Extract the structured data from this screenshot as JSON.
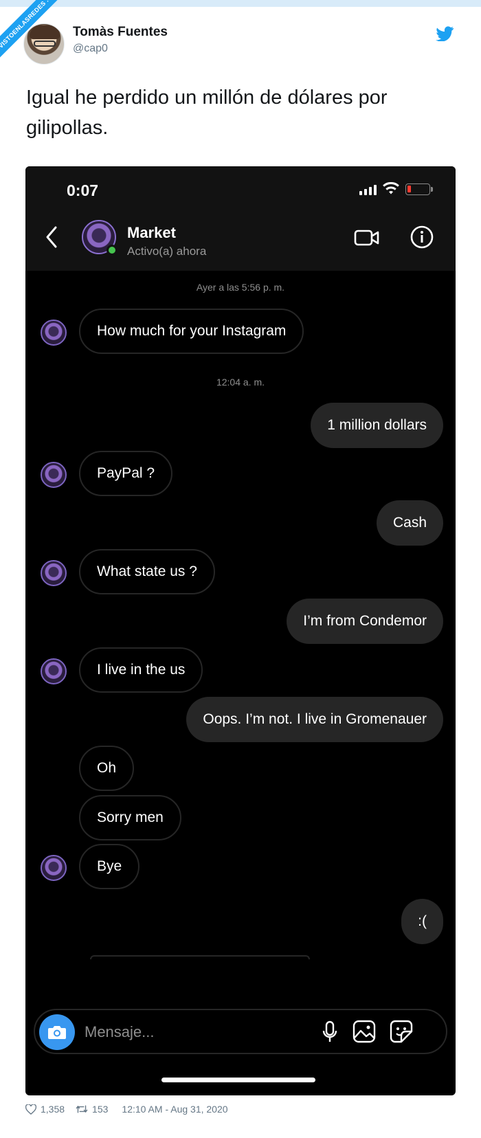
{
  "badge": {
    "text": "VISTOENLASREDES .com"
  },
  "tweet": {
    "user_name": "Tomàs Fuentes",
    "user_handle": "@cap0",
    "text": "Igual he perdido un millón de dólares por gilipollas.",
    "likes": "1,358",
    "retweets": "153",
    "timestamp": "12:10 AM - Aug 31, 2020"
  },
  "phone": {
    "status_time": "0:07",
    "contact_name": "Market",
    "contact_status": "Activo(a) ahora",
    "timestamps": [
      "Ayer a las 5:56 p. m.",
      "12:04 a. m."
    ],
    "messages": [
      {
        "dir": "in",
        "text": "How much for your Instagram"
      },
      {
        "dir": "out",
        "text": "1 million dollars"
      },
      {
        "dir": "in",
        "text": "PayPal ?"
      },
      {
        "dir": "out",
        "text": "Cash"
      },
      {
        "dir": "in",
        "text": "What state us ?"
      },
      {
        "dir": "out",
        "text": "I’m from Condemor"
      },
      {
        "dir": "in",
        "text": "I live in the us"
      },
      {
        "dir": "out",
        "text": "Oops. I’m not. I live in Gromenauer"
      },
      {
        "dir": "in",
        "text": "Oh"
      },
      {
        "dir": "in",
        "text": "Sorry men"
      },
      {
        "dir": "in",
        "text": "Bye"
      },
      {
        "dir": "out",
        "text": ":("
      }
    ],
    "composer_placeholder": "Mensaje...",
    "battery_level": 0.15
  },
  "colors": {
    "twitter_blue": "#1da1f2",
    "bubble_outgoing": "#262626",
    "online_dot": "#46c44f",
    "camera_button": "#3897f0"
  }
}
